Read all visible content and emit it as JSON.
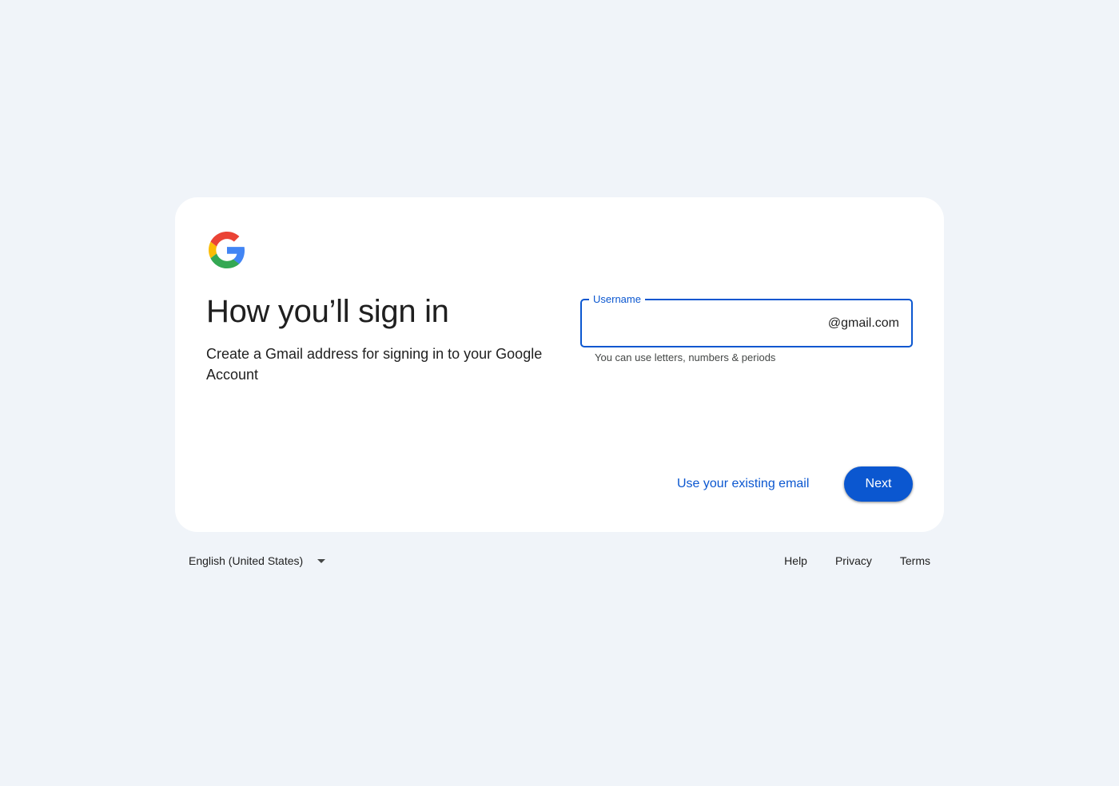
{
  "brand": {
    "logo_icon": "google-g-icon",
    "colors": {
      "blue": "#4285F4",
      "red": "#EA4335",
      "yellow": "#FBBC05",
      "green": "#34A853",
      "accent": "#0b57d0",
      "background": "#f0f4f9"
    }
  },
  "main": {
    "title": "How you’ll sign in",
    "subtitle": "Create a Gmail address for signing in to your Google Account"
  },
  "username_field": {
    "label": "Username",
    "value": "",
    "suffix": "@gmail.com",
    "helper": "You can use letters, numbers & periods"
  },
  "actions": {
    "secondary_label": "Use your existing email",
    "primary_label": "Next"
  },
  "footer": {
    "language": "English (United States)",
    "language_icon": "caret-down-icon",
    "links": [
      "Help",
      "Privacy",
      "Terms"
    ]
  }
}
